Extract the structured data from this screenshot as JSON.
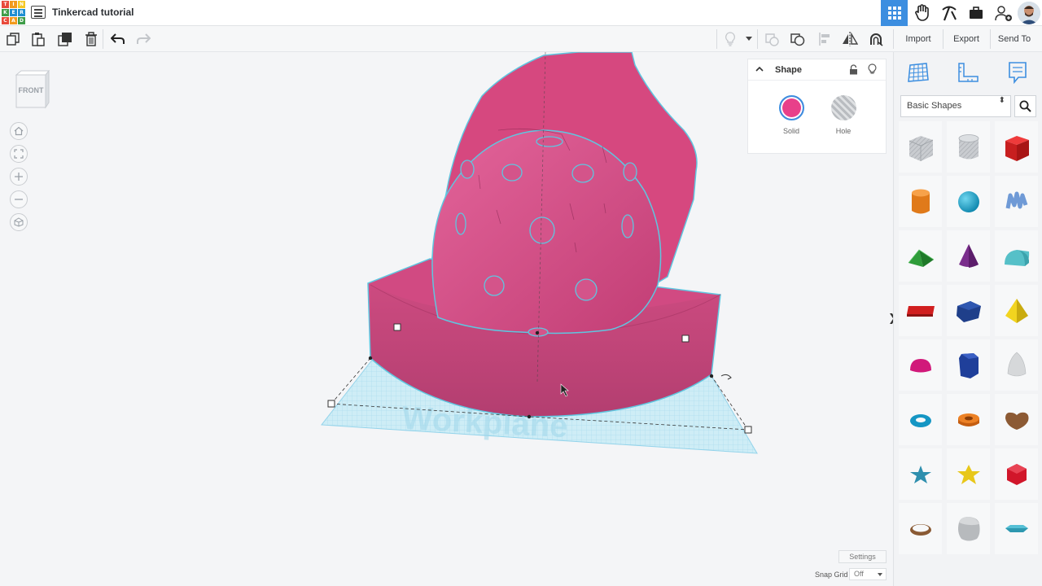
{
  "header": {
    "logo_letters": [
      "T",
      "I",
      "N",
      "K",
      "E",
      "R",
      "C",
      "A",
      "D"
    ],
    "logo_colors": [
      "#e84a3b",
      "#f29a1d",
      "#f5c826",
      "#3f9d49",
      "#1f8fd2",
      "#1f8fd2",
      "#e84a3b",
      "#f29a1d",
      "#3f9d49"
    ],
    "title": "Tinkercad tutorial",
    "icons": [
      "grid-view-icon",
      "tinker-hand-icon",
      "pickaxe-icon",
      "briefcase-icon",
      "add-user-icon",
      "avatar"
    ]
  },
  "toolbar": {
    "left_icons": [
      "copy-icon",
      "paste-icon",
      "duplicate-icon",
      "delete-icon",
      "undo-icon",
      "redo-icon"
    ],
    "right_icons": [
      "light-bulb-icon",
      "dropdown-caret-icon",
      "group-icon",
      "ungroup-icon",
      "align-icon",
      "mirror-icon",
      "cruise-icon"
    ],
    "import_label": "Import",
    "export_label": "Export",
    "send_to_label": "Send To"
  },
  "viewport": {
    "view_cube_label": "FRONT",
    "workplane_label": "Workplane",
    "nav_icons": [
      "home-icon",
      "fit-view-icon",
      "zoom-in-icon",
      "zoom-out-icon",
      "perspective-icon"
    ],
    "settings_label": "Settings",
    "snap_grid_label": "Snap Grid",
    "snap_grid_value": "Off"
  },
  "shape_panel": {
    "title": "Shape",
    "solid_label": "Solid",
    "hole_label": "Hole",
    "solid_color": "#e8408a",
    "accent_color": "#3c8ee0"
  },
  "sidebar": {
    "tabs": [
      "grid-tab-icon",
      "ruler-tab-icon",
      "notes-tab-icon"
    ],
    "dropdown_value": "Basic Shapes",
    "shapes": [
      "box-hole",
      "cylinder-hole",
      "box",
      "cylinder",
      "sphere",
      "scribble",
      "roof",
      "cone",
      "round-roof",
      "text",
      "polygon-prism",
      "pyramid",
      "half-sphere",
      "hexagonal-prism",
      "paraboloid",
      "torus",
      "tube",
      "heart",
      "star",
      "star-gold",
      "polyhedron",
      "ring",
      "round-box",
      "gem"
    ]
  }
}
